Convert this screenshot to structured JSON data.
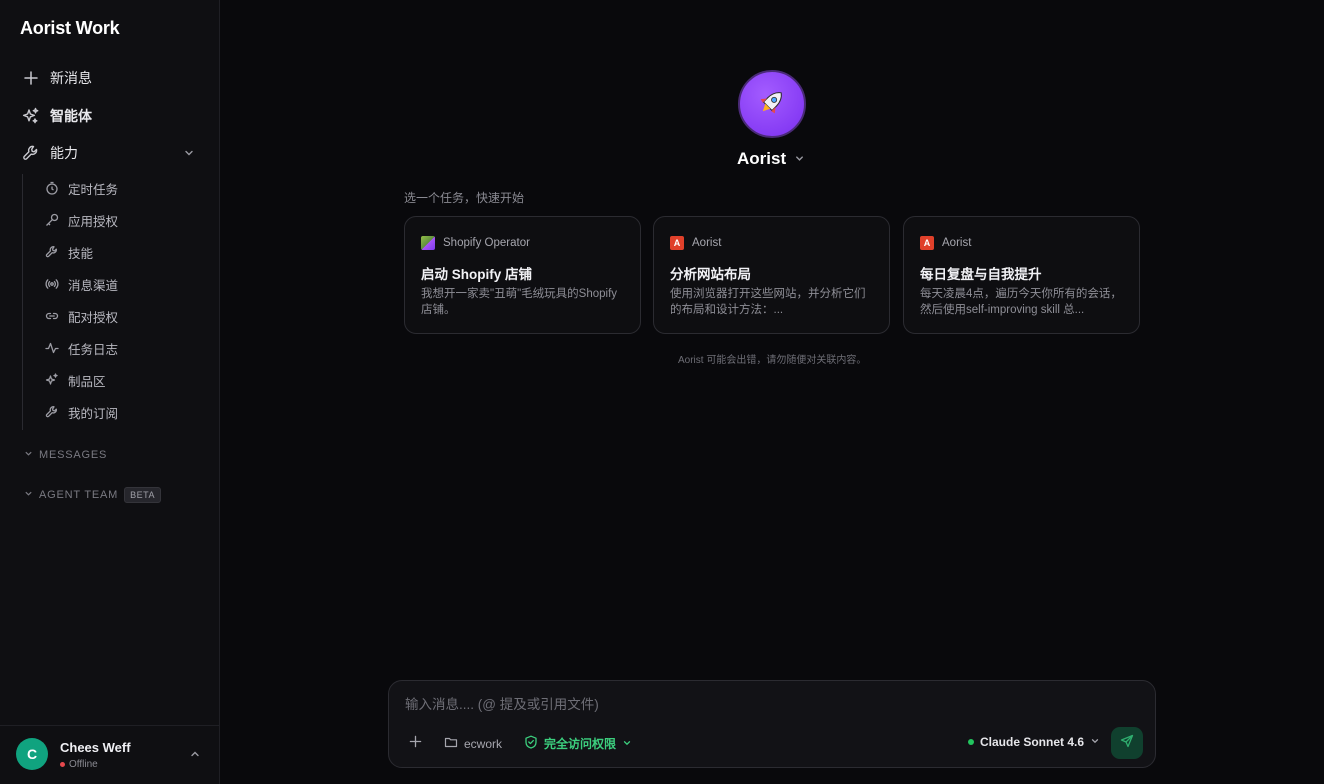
{
  "sidebar": {
    "app_title": "Aorist Work",
    "nav": {
      "new_message": "新消息",
      "agents": "智能体",
      "capabilities": "能力"
    },
    "sub_items": [
      {
        "label": "定时任务",
        "icon": "timer-icon"
      },
      {
        "label": "应用授权",
        "icon": "key-icon"
      },
      {
        "label": "技能",
        "icon": "wrench-icon"
      },
      {
        "label": "消息渠道",
        "icon": "broadcast-icon"
      },
      {
        "label": "配对授权",
        "icon": "link-icon"
      },
      {
        "label": "任务日志",
        "icon": "activity-icon"
      },
      {
        "label": "制品区",
        "icon": "sparkles-icon"
      },
      {
        "label": "我的订阅",
        "icon": "wrench-icon"
      }
    ],
    "sections": {
      "messages": "MESSAGES",
      "agent_team": "AGENT TEAM",
      "agent_team_badge": "BETA"
    },
    "user": {
      "initial": "C",
      "name": "Chees Weff",
      "status": "Offline"
    }
  },
  "main": {
    "agent_name": "Aorist",
    "quick_start_label": "选一个任务，快速开始",
    "cards": [
      {
        "source": "Shopify Operator",
        "title": "启动 Shopify 店铺",
        "desc": "我想开一家卖\"丑萌\"毛绒玩具的Shopify 店铺。"
      },
      {
        "source": "Aorist",
        "title": "分析网站布局",
        "desc": "使用浏览器打开这些网站，并分析它们的布局和设计方法：..."
      },
      {
        "source": "Aorist",
        "title": "每日复盘与自我提升",
        "desc": "每天凌晨4点，遍历今天你所有的会话，然后使用self-improving skill 总..."
      }
    ],
    "disclaimer": "Aorist 可能会出错，请勿随便对关联内容。"
  },
  "composer": {
    "placeholder": "输入消息.... (@ 提及或引用文件)",
    "workspace": "ecwork",
    "access": "完全访问权限",
    "model": "Claude Sonnet 4.6"
  },
  "colors": {
    "accent_green": "#3ccf7e",
    "agent_purple": "#8b3ff5",
    "offline_red": "#e5484d"
  }
}
